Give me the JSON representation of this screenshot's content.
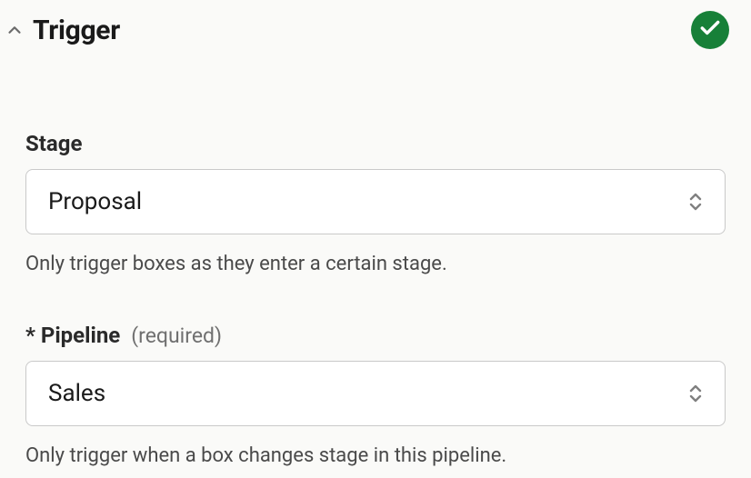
{
  "header": {
    "title": "Trigger"
  },
  "fields": {
    "stage": {
      "label": "Stage",
      "value": "Proposal",
      "helper": "Only trigger boxes as they enter a certain stage."
    },
    "pipeline": {
      "label": "* Pipeline",
      "required_hint": "(required)",
      "value": "Sales",
      "helper": "Only trigger when a box changes stage in this pipeline."
    }
  }
}
